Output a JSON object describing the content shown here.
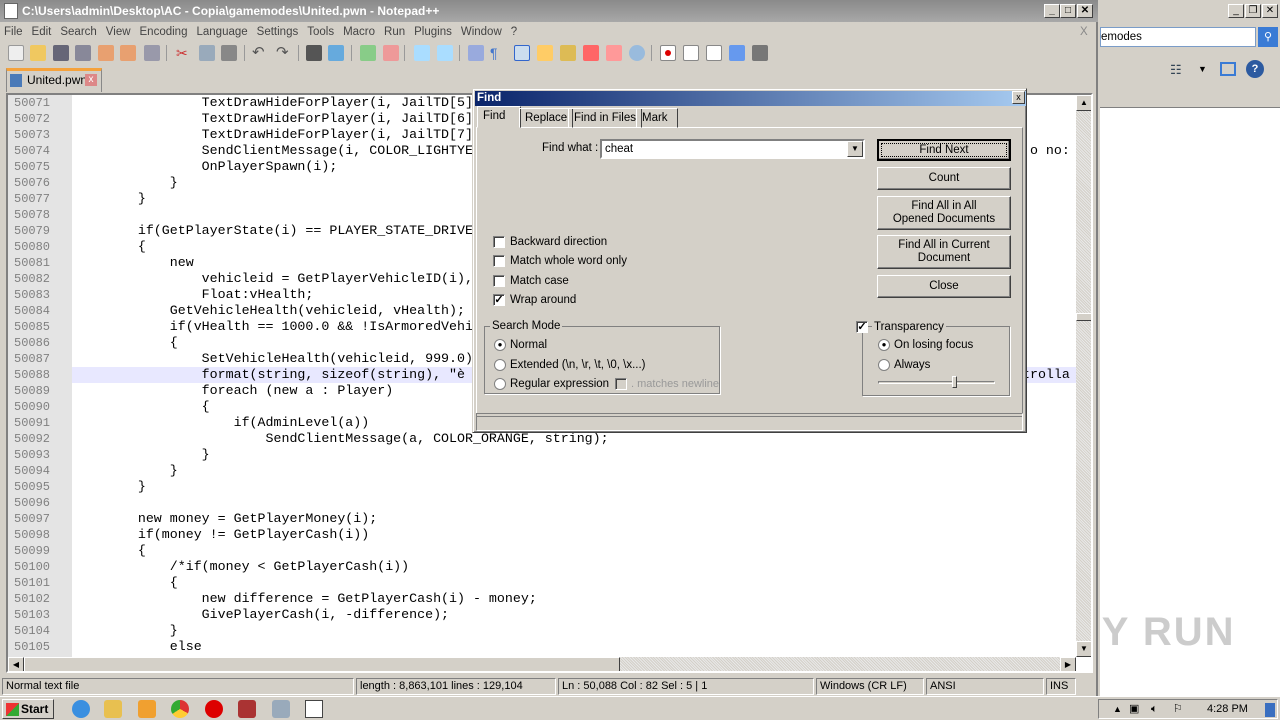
{
  "window": {
    "title": "C:\\Users\\admin\\Desktop\\AC - Copia\\gamemodes\\United.pwn - Notepad++",
    "min": "_",
    "max": "□",
    "close": "✕",
    "doc_close": "X"
  },
  "menu": [
    "File",
    "Edit",
    "Search",
    "View",
    "Encoding",
    "Language",
    "Settings",
    "Tools",
    "Macro",
    "Run",
    "Plugins",
    "Window",
    "?"
  ],
  "tab": {
    "label": "United.pwn",
    "close": "x"
  },
  "editor": {
    "lines": [
      {
        "n": "50071",
        "t": "                TextDrawHideForPlayer(i, JailTD[5]"
      },
      {
        "n": "50072",
        "t": "                TextDrawHideForPlayer(i, JailTD[6]"
      },
      {
        "n": "50073",
        "t": "                TextDrawHideForPlayer(i, JailTD[7]"
      },
      {
        "n": "50074",
        "t": "                SendClientMessage(i, COLOR_LIGHTYE"
      },
      {
        "n": "50075",
        "t": "                OnPlayerSpawn(i);"
      },
      {
        "n": "50076",
        "t": "            }"
      },
      {
        "n": "50077",
        "t": "        }"
      },
      {
        "n": "50078",
        "t": ""
      },
      {
        "n": "50079",
        "t": "        if(GetPlayerState(i) == PLAYER_STATE_DRIVE"
      },
      {
        "n": "50080",
        "t": "        {"
      },
      {
        "n": "50081",
        "t": "            new"
      },
      {
        "n": "50082",
        "t": "                vehicleid = GetPlayerVehicleID(i),"
      },
      {
        "n": "50083",
        "t": "                Float:vHealth;"
      },
      {
        "n": "50084",
        "t": "            GetVehicleHealth(vehicleid, vHealth);"
      },
      {
        "n": "50085",
        "t": "            if(vHealth == 1000.0 && !IsArmoredVehi"
      },
      {
        "n": "50086",
        "t": "            {"
      },
      {
        "n": "50087",
        "t": "                SetVehicleHealth(vehicleid, 999.0)"
      },
      {
        "n": "50088",
        "t": "                format(string, sizeof(string), \"è"
      },
      {
        "n": "50089",
        "t": "                foreach (new a : Player)"
      },
      {
        "n": "50090",
        "t": "                {"
      },
      {
        "n": "50091",
        "t": "                    if(AdminLevel(a))"
      },
      {
        "n": "50092",
        "t": "                        SendClientMessage(a, COLOR_ORANGE, string);"
      },
      {
        "n": "50093",
        "t": "                }"
      },
      {
        "n": "50094",
        "t": "            }"
      },
      {
        "n": "50095",
        "t": "        }"
      },
      {
        "n": "50096",
        "t": ""
      },
      {
        "n": "50097",
        "t": "        new money = GetPlayerMoney(i);"
      },
      {
        "n": "50098",
        "t": "        if(money != GetPlayerCash(i))"
      },
      {
        "n": "50099",
        "t": "        {"
      },
      {
        "n": "50100",
        "t": "            /*if(money < GetPlayerCash(i))"
      },
      {
        "n": "50101",
        "t": "            {"
      },
      {
        "n": "50102",
        "t": "                new difference = GetPlayerCash(i) - money;"
      },
      {
        "n": "50103",
        "t": "                GivePlayerCash(i, -difference);"
      },
      {
        "n": "50104",
        "t": "            }"
      },
      {
        "n": "50105",
        "t": "            else"
      }
    ],
    "fragment_50074": "? o no:",
    "fragment_50088": "ntrolla"
  },
  "status": {
    "type": "Normal text file",
    "length": "length : 8,863,101    lines : 129,104",
    "pos": "Ln : 50,088    Col : 82    Sel : 5 | 1",
    "eol": "Windows (CR LF)",
    "enc": "ANSI",
    "mode": "INS"
  },
  "find": {
    "title": "Find",
    "close": "x",
    "tabs": [
      "Find",
      "Replace",
      "Find in Files",
      "Mark"
    ],
    "find_what_label": "Find what :",
    "find_what_value": "cheat",
    "buttons": [
      "Find Next",
      "Count",
      "Find All in All Opened Documents",
      "Find All in Current Document",
      "Close"
    ],
    "options": [
      {
        "label": "Backward direction",
        "checked": false
      },
      {
        "label": "Match whole word only",
        "checked": false
      },
      {
        "label": "Match case",
        "checked": false
      },
      {
        "label": "Wrap around",
        "checked": true
      }
    ],
    "search_mode": {
      "title": "Search Mode",
      "options": [
        "Normal",
        "Extended (\\n, \\r, \\t, \\0, \\x...)",
        "Regular expression"
      ],
      "selected": 0,
      "matches_newline": ". matches newline"
    },
    "transparency": {
      "label": "Transparency",
      "checked": true,
      "options": [
        "On losing focus",
        "Always"
      ],
      "selected": 0,
      "level": 0.65
    }
  },
  "bgwin": {
    "search_value": "emodes"
  },
  "taskbar": {
    "start": "Start",
    "time": "4:28 PM"
  },
  "watermark": "ANY RUN"
}
